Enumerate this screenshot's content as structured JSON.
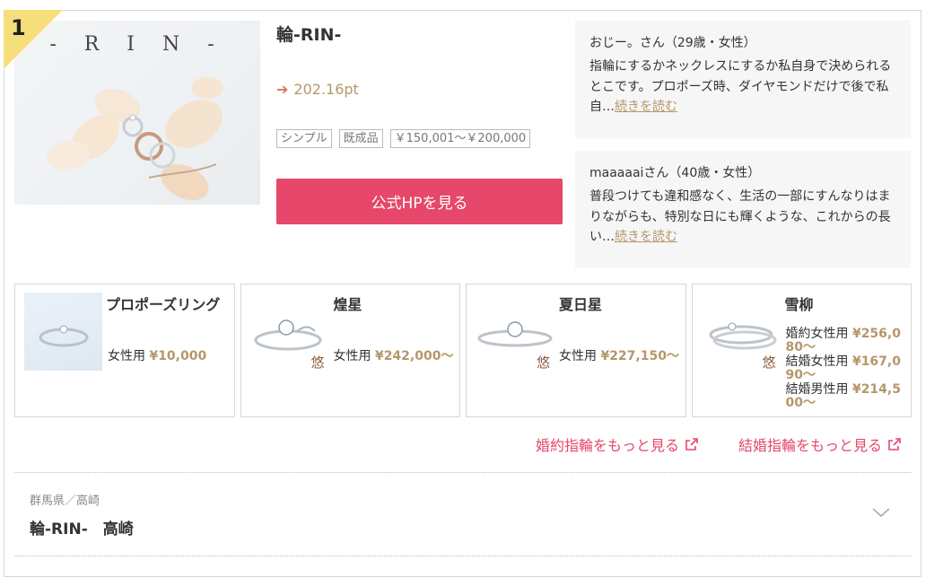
{
  "rank": "1",
  "shop": {
    "title": "輪-RIN-",
    "photo_logo": "- R I N -",
    "points": "202.16pt",
    "tags": [
      "シンプル",
      "既成品",
      "￥150,001～￥200,000"
    ],
    "hp_button": "公式HPを見る"
  },
  "reviews": [
    {
      "who": "おじー。さん（29歳・女性）",
      "text": "指輪にするかネックレスにするか私自身で決められるとこです。プロポーズ時、ダイヤモンドだけで後で私自…",
      "more": "続きを読む"
    },
    {
      "who": "maaaaaiさん（40歳・女性）",
      "text": "普段つけても違和感なく、生活の一部にすんなりはまりながらも、特別な日にも輝くような、これからの長い…",
      "more": "続きを読む"
    }
  ],
  "products": [
    {
      "name": "プロポーズリング",
      "prices": [
        {
          "label": "女性用",
          "value": "¥10,000"
        }
      ]
    },
    {
      "name": "煌星",
      "mark": "悠",
      "prices": [
        {
          "label": "女性用",
          "value": "¥242,000～"
        }
      ]
    },
    {
      "name": "夏日星",
      "mark": "悠",
      "prices": [
        {
          "label": "女性用",
          "value": "¥227,150～"
        }
      ]
    },
    {
      "name": "雪柳",
      "mark": "悠",
      "prices": [
        {
          "label": "婚約女性用",
          "value": "¥256,080～"
        },
        {
          "label": "結婚女性用",
          "value": "¥167,090～"
        },
        {
          "label": "結婚男性用",
          "value": "¥214,500～"
        }
      ]
    }
  ],
  "links": {
    "engagement": "婚約指輪をもっと見る",
    "wedding": "結婚指輪をもっと見る"
  },
  "store": {
    "location": "群馬県／高崎",
    "name": "輪-RIN-　高崎"
  },
  "colors": {
    "accent_pink": "#e6476a",
    "gold": "#b5976a",
    "rank_corner": "#f6df7a"
  }
}
